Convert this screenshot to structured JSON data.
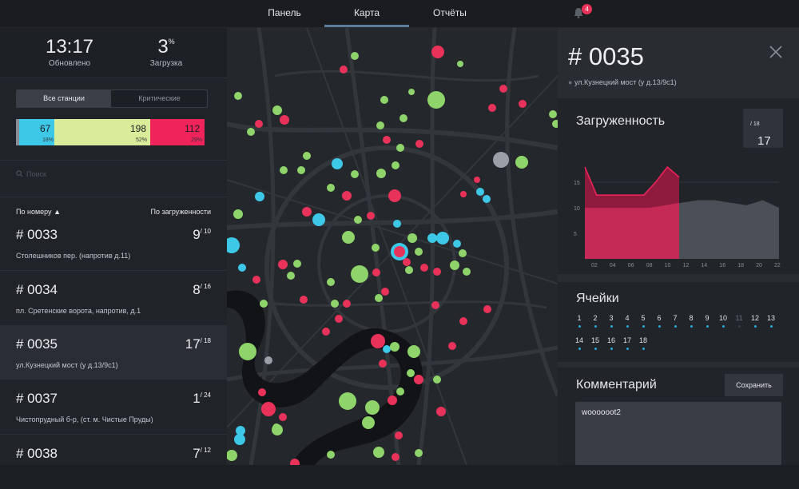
{
  "nav": {
    "tabs": [
      {
        "label": "Панель"
      },
      {
        "label": "Карта"
      },
      {
        "label": "Отчёты"
      }
    ],
    "active_tab": "Карта",
    "notifications": "4"
  },
  "stats": {
    "time": "13:17",
    "time_label": "Обновлено",
    "load_value": "3",
    "load_unit": "%",
    "load_label": "Загрузка"
  },
  "filter": {
    "all": "Все станции",
    "critical": "Критические",
    "active": "Все станции"
  },
  "distribution": {
    "segments": [
      {
        "value": "67",
        "percent": "18%",
        "color": "#3ec8e8"
      },
      {
        "value": "198",
        "percent": "52%",
        "color": "#d9ec9a"
      },
      {
        "value": "112",
        "percent": "29%",
        "color": "#f0235a"
      }
    ]
  },
  "search": {
    "placeholder": "Поиск"
  },
  "sort": {
    "by_number": "По номеру",
    "by_load": "По загруженности"
  },
  "stations": [
    {
      "number": "# 0033",
      "load": "9",
      "capacity": "/ 10",
      "address": "Столешников пер. (напротив д.11)",
      "selected": false
    },
    {
      "number": "# 0034",
      "load": "8",
      "capacity": "/ 16",
      "address": "пл. Сретенские ворота, напротив, д.1",
      "selected": false
    },
    {
      "number": "# 0035",
      "load": "17",
      "capacity": "/ 18",
      "address": "ул.Кузнецкий мост (у д.13/9с1)",
      "selected": true
    },
    {
      "number": "# 0037",
      "load": "1",
      "capacity": "/ 24",
      "address": "Чистопрудный б-р, (ст. м. Чистые Пруды)",
      "selected": false
    },
    {
      "number": "# 0038",
      "load": "7",
      "capacity": "/ 12",
      "address": "",
      "selected": false
    }
  ],
  "detail": {
    "title": "# 0035",
    "address": "ул.Кузнецкий мост (у д.13/9с1)",
    "load_title": "Загруженность",
    "load_value": "17",
    "load_capacity": "/ 18",
    "cells_title": "Ячейки",
    "cells_row1": [
      "1",
      "2",
      "3",
      "4",
      "5",
      "6",
      "7",
      "8",
      "9",
      "10",
      "11",
      "12",
      "13"
    ],
    "cells_row2": [
      "14",
      "15",
      "16",
      "17",
      "18"
    ],
    "comment_title": "Комментарий",
    "save_label": "Сохранить",
    "comment_text": "woooooot2"
  },
  "chart_data": {
    "type": "area",
    "x": [
      "02",
      "04",
      "06",
      "08",
      "10",
      "12",
      "14",
      "16",
      "18",
      "20",
      "22"
    ],
    "y_ticks": [
      "5",
      "10",
      "15"
    ],
    "ylim": [
      0,
      18
    ],
    "series": [
      {
        "values": [
          10,
          10,
          10,
          10,
          10,
          10.5,
          11,
          11.5,
          11.5,
          11,
          10.5,
          11.5,
          10
        ]
      },
      {
        "values": [
          18,
          12.5,
          12.5,
          12.5,
          12.5,
          12.5,
          15,
          18,
          16
        ]
      }
    ]
  },
  "map_dots": [
    {
      "cx": 264,
      "cy": 30,
      "r": 8,
      "color": "#e8325a"
    },
    {
      "cx": 146,
      "cy": 52,
      "r": 5,
      "color": "#e8325a"
    },
    {
      "cx": 160,
      "cy": 35,
      "r": 5,
      "color": "#8fd46a"
    },
    {
      "cx": 262,
      "cy": 90,
      "r": 11,
      "color": "#8fd46a"
    },
    {
      "cx": 231,
      "cy": 80,
      "r": 4,
      "color": "#8fd46a"
    },
    {
      "cx": 292,
      "cy": 45,
      "r": 4,
      "color": "#8fd46a"
    },
    {
      "cx": 332,
      "cy": 100,
      "r": 5,
      "color": "#e8325a"
    },
    {
      "cx": 346,
      "cy": 76,
      "r": 5,
      "color": "#e8325a"
    },
    {
      "cx": 370,
      "cy": 95,
      "r": 5,
      "color": "#e8325a"
    },
    {
      "cx": 408,
      "cy": 108,
      "r": 5,
      "color": "#8fd46a"
    },
    {
      "cx": 412,
      "cy": 120,
      "r": 5,
      "color": "#8fd46a"
    },
    {
      "cx": 14,
      "cy": 85,
      "r": 5,
      "color": "#8fd46a"
    },
    {
      "cx": 63,
      "cy": 103,
      "r": 6,
      "color": "#8fd46a"
    },
    {
      "cx": 72,
      "cy": 115,
      "r": 6,
      "color": "#e8325a"
    },
    {
      "cx": 40,
      "cy": 120,
      "r": 5,
      "color": "#e8325a"
    },
    {
      "cx": 30,
      "cy": 130,
      "r": 5,
      "color": "#8fd46a"
    },
    {
      "cx": 197,
      "cy": 90,
      "r": 5,
      "color": "#8fd46a"
    },
    {
      "cx": 221,
      "cy": 113,
      "r": 5,
      "color": "#8fd46a"
    },
    {
      "cx": 192,
      "cy": 122,
      "r": 5,
      "color": "#8fd46a"
    },
    {
      "cx": 200,
      "cy": 140,
      "r": 5,
      "color": "#e8325a"
    },
    {
      "cx": 217,
      "cy": 150,
      "r": 5,
      "color": "#8fd46a"
    },
    {
      "cx": 241,
      "cy": 145,
      "r": 5,
      "color": "#e8325a"
    },
    {
      "cx": 343,
      "cy": 165,
      "r": 10,
      "color": "#9aa0a6"
    },
    {
      "cx": 369,
      "cy": 168,
      "r": 8,
      "color": "#8fd46a"
    },
    {
      "cx": 317,
      "cy": 205,
      "r": 5,
      "color": "#3ec8e8"
    },
    {
      "cx": 325,
      "cy": 214,
      "r": 5,
      "color": "#3ec8e8"
    },
    {
      "cx": 296,
      "cy": 208,
      "r": 4,
      "color": "#e8325a"
    },
    {
      "cx": 313,
      "cy": 190,
      "r": 4,
      "color": "#e8325a"
    },
    {
      "cx": 138,
      "cy": 170,
      "r": 7,
      "color": "#3ec8e8"
    },
    {
      "cx": 160,
      "cy": 183,
      "r": 5,
      "color": "#8fd46a"
    },
    {
      "cx": 130,
      "cy": 200,
      "r": 5,
      "color": "#8fd46a"
    },
    {
      "cx": 150,
      "cy": 210,
      "r": 6,
      "color": "#e8325a"
    },
    {
      "cx": 210,
      "cy": 210,
      "r": 8,
      "color": "#e8325a"
    },
    {
      "cx": 193,
      "cy": 182,
      "r": 6,
      "color": "#8fd46a"
    },
    {
      "cx": 211,
      "cy": 172,
      "r": 5,
      "color": "#8fd46a"
    },
    {
      "cx": 100,
      "cy": 160,
      "r": 5,
      "color": "#8fd46a"
    },
    {
      "cx": 93,
      "cy": 178,
      "r": 5,
      "color": "#8fd46a"
    },
    {
      "cx": 71,
      "cy": 178,
      "r": 5,
      "color": "#8fd46a"
    },
    {
      "cx": 41,
      "cy": 211,
      "r": 6,
      "color": "#3ec8e8"
    },
    {
      "cx": 14,
      "cy": 233,
      "r": 6,
      "color": "#8fd46a"
    },
    {
      "cx": 115,
      "cy": 240,
      "r": 8,
      "color": "#3ec8e8"
    },
    {
      "cx": 100,
      "cy": 230,
      "r": 6,
      "color": "#e8325a"
    },
    {
      "cx": 180,
      "cy": 235,
      "r": 5,
      "color": "#e8325a"
    },
    {
      "cx": 213,
      "cy": 245,
      "r": 5,
      "color": "#3ec8e8"
    },
    {
      "cx": 232,
      "cy": 263,
      "r": 6,
      "color": "#8fd46a"
    },
    {
      "cx": 240,
      "cy": 280,
      "r": 5,
      "color": "#8fd46a"
    },
    {
      "cx": 257,
      "cy": 263,
      "r": 6,
      "color": "#3ec8e8"
    },
    {
      "cx": 270,
      "cy": 263,
      "r": 8,
      "color": "#3ec8e8"
    },
    {
      "cx": 288,
      "cy": 270,
      "r": 5,
      "color": "#3ec8e8"
    },
    {
      "cx": 295,
      "cy": 282,
      "r": 5,
      "color": "#8fd46a"
    },
    {
      "cx": 216,
      "cy": 280,
      "r": 11,
      "color": "#3ec8e8"
    },
    {
      "cx": 216,
      "cy": 280,
      "r": 7,
      "color": "#e8325a"
    },
    {
      "cx": 152,
      "cy": 262,
      "r": 8,
      "color": "#8fd46a"
    },
    {
      "cx": 186,
      "cy": 275,
      "r": 5,
      "color": "#8fd46a"
    },
    {
      "cx": 164,
      "cy": 240,
      "r": 5,
      "color": "#8fd46a"
    },
    {
      "cx": 166,
      "cy": 308,
      "r": 11,
      "color": "#8fd46a"
    },
    {
      "cx": 187,
      "cy": 306,
      "r": 5,
      "color": "#e8325a"
    },
    {
      "cx": 225,
      "cy": 293,
      "r": 5,
      "color": "#e8325a"
    },
    {
      "cx": 228,
      "cy": 303,
      "r": 5,
      "color": "#8fd46a"
    },
    {
      "cx": 247,
      "cy": 300,
      "r": 5,
      "color": "#e8325a"
    },
    {
      "cx": 263,
      "cy": 305,
      "r": 5,
      "color": "#e8325a"
    },
    {
      "cx": 285,
      "cy": 297,
      "r": 6,
      "color": "#8fd46a"
    },
    {
      "cx": 300,
      "cy": 305,
      "r": 5,
      "color": "#8fd46a"
    },
    {
      "cx": 70,
      "cy": 296,
      "r": 6,
      "color": "#e8325a"
    },
    {
      "cx": 88,
      "cy": 295,
      "r": 5,
      "color": "#8fd46a"
    },
    {
      "cx": 80,
      "cy": 310,
      "r": 5,
      "color": "#8fd46a"
    },
    {
      "cx": 6,
      "cy": 272,
      "r": 10,
      "color": "#3ec8e8"
    },
    {
      "cx": 19,
      "cy": 300,
      "r": 5,
      "color": "#3ec8e8"
    },
    {
      "cx": 37,
      "cy": 315,
      "r": 5,
      "color": "#e8325a"
    },
    {
      "cx": 130,
      "cy": 318,
      "r": 5,
      "color": "#8fd46a"
    },
    {
      "cx": 150,
      "cy": 345,
      "r": 5,
      "color": "#e8325a"
    },
    {
      "cx": 96,
      "cy": 340,
      "r": 5,
      "color": "#e8325a"
    },
    {
      "cx": 46,
      "cy": 345,
      "r": 5,
      "color": "#8fd46a"
    },
    {
      "cx": 135,
      "cy": 345,
      "r": 5,
      "color": "#8fd46a"
    },
    {
      "cx": 190,
      "cy": 338,
      "r": 5,
      "color": "#8fd46a"
    },
    {
      "cx": 198,
      "cy": 330,
      "r": 5,
      "color": "#e8325a"
    },
    {
      "cx": 261,
      "cy": 347,
      "r": 5,
      "color": "#e8325a"
    },
    {
      "cx": 296,
      "cy": 367,
      "r": 5,
      "color": "#e8325a"
    },
    {
      "cx": 326,
      "cy": 352,
      "r": 5,
      "color": "#e8325a"
    },
    {
      "cx": 124,
      "cy": 380,
      "r": 5,
      "color": "#e8325a"
    },
    {
      "cx": 140,
      "cy": 364,
      "r": 5,
      "color": "#e8325a"
    },
    {
      "cx": 189,
      "cy": 392,
      "r": 9,
      "color": "#e8325a"
    },
    {
      "cx": 200,
      "cy": 402,
      "r": 5,
      "color": "#3ec8e8"
    },
    {
      "cx": 210,
      "cy": 399,
      "r": 6,
      "color": "#8fd46a"
    },
    {
      "cx": 234,
      "cy": 405,
      "r": 8,
      "color": "#8fd46a"
    },
    {
      "cx": 282,
      "cy": 398,
      "r": 5,
      "color": "#e8325a"
    },
    {
      "cx": 26,
      "cy": 405,
      "r": 11,
      "color": "#8fd46a"
    },
    {
      "cx": 52,
      "cy": 416,
      "r": 5,
      "color": "#9aa0a6"
    },
    {
      "cx": 195,
      "cy": 420,
      "r": 5,
      "color": "#e8325a"
    },
    {
      "cx": 230,
      "cy": 432,
      "r": 5,
      "color": "#8fd46a"
    },
    {
      "cx": 240,
      "cy": 440,
      "r": 6,
      "color": "#e8325a"
    },
    {
      "cx": 263,
      "cy": 440,
      "r": 5,
      "color": "#8fd46a"
    },
    {
      "cx": 151,
      "cy": 467,
      "r": 11,
      "color": "#8fd46a"
    },
    {
      "cx": 182,
      "cy": 475,
      "r": 9,
      "color": "#8fd46a"
    },
    {
      "cx": 207,
      "cy": 466,
      "r": 6,
      "color": "#e8325a"
    },
    {
      "cx": 217,
      "cy": 455,
      "r": 5,
      "color": "#8fd46a"
    },
    {
      "cx": 52,
      "cy": 477,
      "r": 9,
      "color": "#e8325a"
    },
    {
      "cx": 44,
      "cy": 456,
      "r": 5,
      "color": "#e8325a"
    },
    {
      "cx": 70,
      "cy": 487,
      "r": 5,
      "color": "#e8325a"
    },
    {
      "cx": 62,
      "cy": 500,
      "r": 5,
      "color": "#8fd46a"
    },
    {
      "cx": 63,
      "cy": 503,
      "r": 7,
      "color": "#8fd46a"
    },
    {
      "cx": 17,
      "cy": 504,
      "r": 6,
      "color": "#3ec8e8"
    },
    {
      "cx": 177,
      "cy": 494,
      "r": 8,
      "color": "#8fd46a"
    },
    {
      "cx": 215,
      "cy": 510,
      "r": 5,
      "color": "#e8325a"
    },
    {
      "cx": 268,
      "cy": 480,
      "r": 6,
      "color": "#e8325a"
    },
    {
      "cx": 190,
      "cy": 531,
      "r": 7,
      "color": "#8fd46a"
    },
    {
      "cx": 211,
      "cy": 537,
      "r": 5,
      "color": "#e8325a"
    },
    {
      "cx": 240,
      "cy": 532,
      "r": 5,
      "color": "#8fd46a"
    },
    {
      "cx": 6,
      "cy": 535,
      "r": 7,
      "color": "#8fd46a"
    },
    {
      "cx": 16,
      "cy": 515,
      "r": 7,
      "color": "#3ec8e8"
    },
    {
      "cx": 130,
      "cy": 534,
      "r": 5,
      "color": "#8fd46a"
    },
    {
      "cx": 85,
      "cy": 545,
      "r": 6,
      "color": "#e8325a"
    }
  ]
}
